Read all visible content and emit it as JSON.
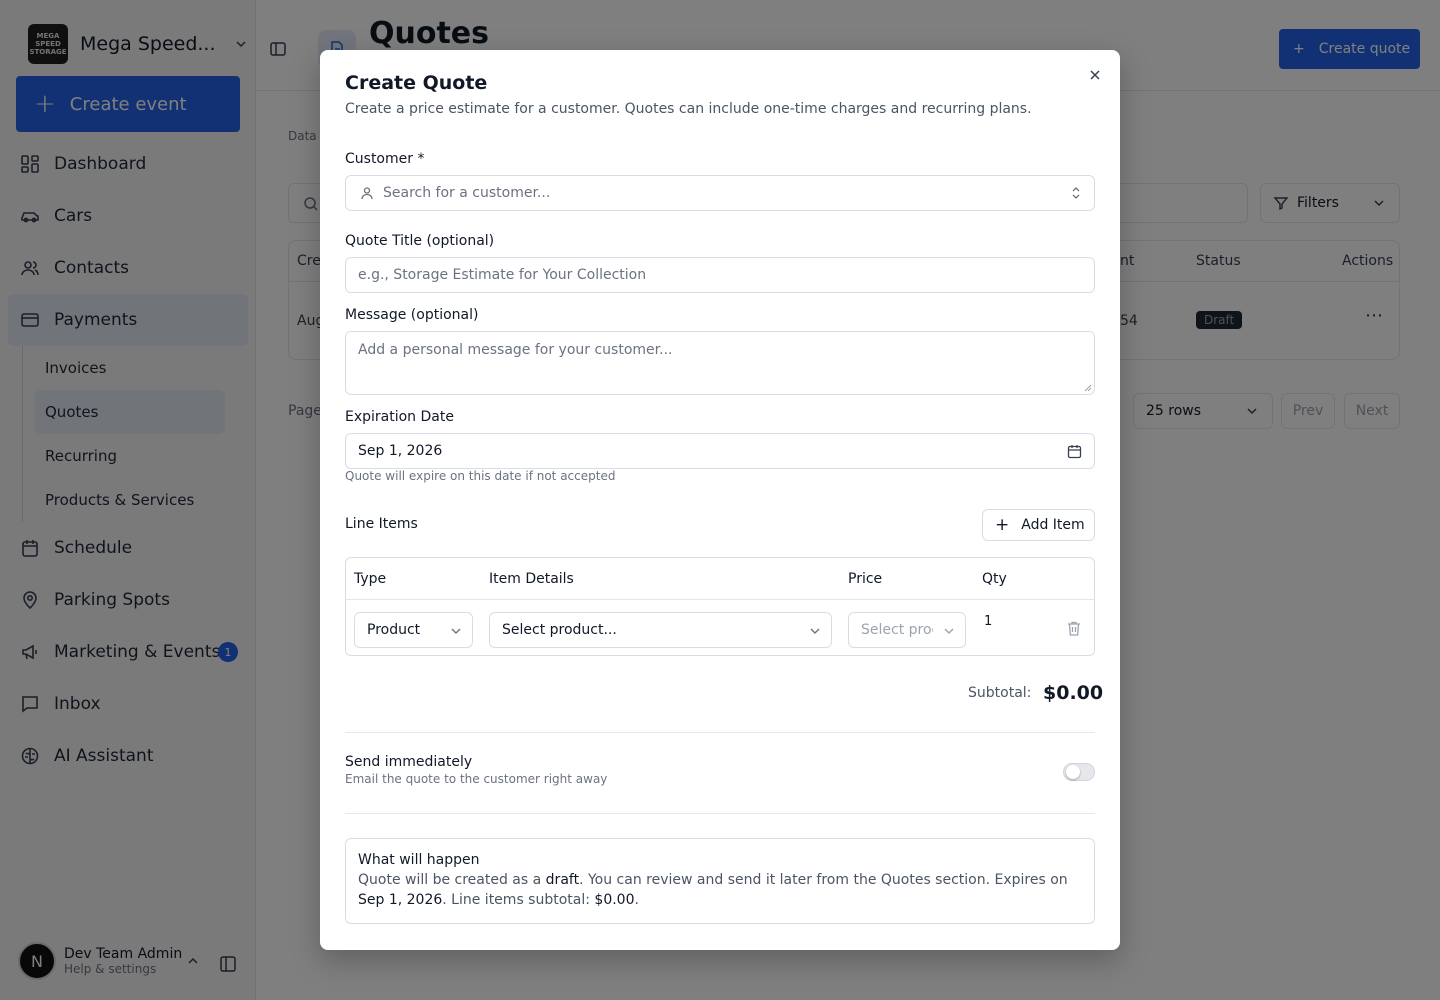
{
  "sidebar": {
    "brand": "Mega Speed...",
    "logo_text": "MEGA SPEED STORAGE",
    "create_event": "Create event",
    "nav": [
      {
        "label": "Dashboard",
        "icon": "dashboard-icon"
      },
      {
        "label": "Cars",
        "icon": "car-icon"
      },
      {
        "label": "Contacts",
        "icon": "contacts-icon"
      },
      {
        "label": "Payments",
        "icon": "credit-card-icon"
      }
    ],
    "payments_sub": [
      "Invoices",
      "Quotes",
      "Recurring",
      "Products & Services"
    ],
    "nav_lower": [
      {
        "label": "Schedule",
        "icon": "calendar-icon"
      },
      {
        "label": "Parking Spots",
        "icon": "map-pin-icon"
      },
      {
        "label": "Marketing & Events",
        "icon": "megaphone-icon",
        "badge": "1"
      },
      {
        "label": "Inbox",
        "icon": "message-icon"
      },
      {
        "label": "AI Assistant",
        "icon": "brain-icon"
      }
    ],
    "user": {
      "initial": "N",
      "name": "Dev Team Admin",
      "sub": "Help & settings"
    }
  },
  "main": {
    "title": "Quotes",
    "create_quote": "Create quote",
    "crumb": "Data l",
    "filters": "Filters",
    "table": {
      "headers": {
        "created": "Cre",
        "amount": "nt",
        "status": "Status",
        "actions": "Actions"
      },
      "row": {
        "created": "Aug",
        "amount": "54",
        "status": "Draft"
      }
    },
    "page_label": "Page",
    "rows": "25 rows",
    "prev": "Prev",
    "next": "Next"
  },
  "modal": {
    "title": "Create Quote",
    "description": "Create a price estimate for a customer. Quotes can include one-time charges and recurring plans.",
    "customer_label": "Customer *",
    "customer_placeholder": "Search for a customer...",
    "title_label": "Quote Title (optional)",
    "title_placeholder": "e.g., Storage Estimate for Your Collection",
    "message_label": "Message (optional)",
    "message_placeholder": "Add a personal message for your customer...",
    "expiration_label": "Expiration Date",
    "expiration_value": "Sep 1, 2026",
    "expiration_help": "Quote will expire on this date if not accepted",
    "line_items_label": "Line Items",
    "add_item": "Add Item",
    "columns": [
      "Type",
      "Item Details",
      "Price",
      "Qty"
    ],
    "line": {
      "type": "Product",
      "product": "Select product...",
      "price": "Select proc",
      "qty": "1"
    },
    "subtotal_label": "Subtotal:",
    "subtotal_value": "$0.00",
    "send_title": "Send immediately",
    "send_sub": "Email the quote to the customer right away",
    "send_enabled": false,
    "info_title": "What will happen",
    "info": {
      "p1": "Quote will be created as a ",
      "draft": "draft",
      "p2": ". You can review and send it later from the Quotes section. Expires on ",
      "date": "Sep 1, 2026",
      "p3": ". Line items subtotal: ",
      "amount": "$0.00",
      "p4": "."
    }
  },
  "colors": {
    "accent": "#2563eb",
    "overlay": "rgba(0,0,0,0.5)"
  }
}
